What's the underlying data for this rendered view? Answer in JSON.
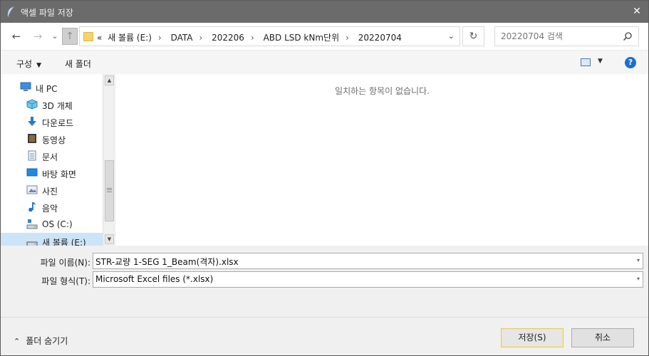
{
  "window": {
    "title": "액셀 파일 저장",
    "close_glyph": "✕"
  },
  "navigation": {
    "back_glyph": "←",
    "forward_glyph": "→",
    "history_glyph": "⌄",
    "up_glyph": "↑",
    "address_prefix": "«",
    "breadcrumbs": [
      "새 볼륨 (E:)",
      "DATA",
      "202206",
      "ABD LSD kNm단위",
      "20220704"
    ],
    "separator": "›",
    "dropdown_glyph": "⌄",
    "refresh_glyph": "↻",
    "search_placeholder": "20220704 검색"
  },
  "toolbar": {
    "organize_label": "구성",
    "organize_caret": "▼",
    "new_folder_label": "새 폴더",
    "view_caret": "▼",
    "help_glyph": "?"
  },
  "sidebar": {
    "items": [
      {
        "label": "내 PC",
        "icon": "pc-icon"
      },
      {
        "label": "3D 개체",
        "icon": "3d-objects-icon"
      },
      {
        "label": "다운로드",
        "icon": "download-icon"
      },
      {
        "label": "동영상",
        "icon": "video-icon"
      },
      {
        "label": "문서",
        "icon": "document-icon"
      },
      {
        "label": "바탕 화면",
        "icon": "desktop-icon"
      },
      {
        "label": "사진",
        "icon": "pictures-icon"
      },
      {
        "label": "음악",
        "icon": "music-icon"
      },
      {
        "label": "OS (C:)",
        "icon": "drive-icon"
      },
      {
        "label": "새 볼륨 (E:)",
        "icon": "drive-icon"
      }
    ],
    "scroll_up_glyph": "▲",
    "scroll_down_glyph": "▼"
  },
  "content": {
    "empty_message": "일치하는 항목이 없습니다."
  },
  "form": {
    "filename_label": "파일 이름(N):",
    "filename_value": "STR-교량 1-SEG 1_Beam(격자).xlsx",
    "filetype_label": "파일 형식(T):",
    "filetype_value": "Microsoft Excel files (*.xlsx)",
    "dropdown_glyph": "▾"
  },
  "footer": {
    "hide_folders_glyph": "⌃",
    "hide_folders_label": "폴더 숨기기",
    "save_label": "저장(S)",
    "cancel_label": "취소"
  },
  "colors": {
    "titlebar": "#6b6b6b",
    "selection": "#cce4f7",
    "help_blue": "#1b6fce",
    "folder_yellow": "#f6d36b",
    "primary_border": "#e0c96b"
  }
}
